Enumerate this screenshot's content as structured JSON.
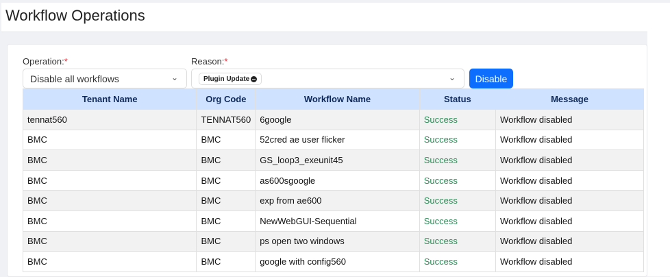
{
  "page": {
    "title": "Workflow Operations"
  },
  "form": {
    "operation_label": "Operation:",
    "operation_value": "Disable all workflows",
    "reason_label": "Reason:",
    "reason_chip": "Plugin Update",
    "required_marker": "*",
    "disable_label": "Disable"
  },
  "table": {
    "headers": [
      "Tenant Name",
      "Org Code",
      "Workflow Name",
      "Status",
      "Message"
    ],
    "rows": [
      [
        "tennat560",
        "TENNAT560",
        "6google",
        "Success",
        "Workflow disabled"
      ],
      [
        "BMC",
        "BMC",
        "52cred ae user flicker",
        "Success",
        "Workflow disabled"
      ],
      [
        "BMC",
        "BMC",
        "GS_loop3_exeunit45",
        "Success",
        "Workflow disabled"
      ],
      [
        "BMC",
        "BMC",
        "as600sgoogle",
        "Success",
        "Workflow disabled"
      ],
      [
        "BMC",
        "BMC",
        "exp from ae600",
        "Success",
        "Workflow disabled"
      ],
      [
        "BMC",
        "BMC",
        "NewWebGUI-Sequential",
        "Success",
        "Workflow disabled"
      ],
      [
        "BMC",
        "BMC",
        "ps open two windows",
        "Success",
        "Workflow disabled"
      ],
      [
        "BMC",
        "BMC",
        "google with config560",
        "Success",
        "Workflow disabled"
      ]
    ]
  },
  "colors": {
    "primary": "#0d6efd",
    "success": "#2e8b57",
    "header_bg": "#cfe2ff"
  }
}
